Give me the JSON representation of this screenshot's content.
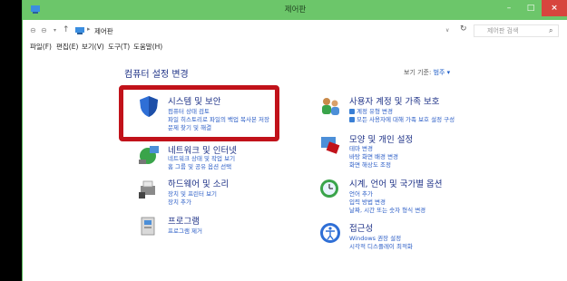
{
  "window": {
    "title": "제어판",
    "min_label": "–",
    "max_label": "□",
    "close_label": "×"
  },
  "address": {
    "back": "⊖",
    "forward": "⊖",
    "dropdown": "▾",
    "up": "↑",
    "separator": "▸",
    "path": "제어판",
    "path_dropdown": "∨",
    "refresh": "↻",
    "search_placeholder": "제어판 검색",
    "search_icon": "⌕"
  },
  "menu": [
    "파일(F)",
    "편집(E)",
    "보기(V)",
    "도구(T)",
    "도움말(H)"
  ],
  "content": {
    "title": "컴퓨터 설정 변경",
    "view_by_label": "보기 기준:",
    "view_by_value": "범주 ▾"
  },
  "categories": {
    "system": {
      "title": "시스템 및 보안",
      "links": [
        "컴퓨터 상태 검토",
        "파일 히스토리로 파일의 백업 복사본 저장",
        "문제 찾기 및 해결"
      ]
    },
    "network": {
      "title": "네트워크 및 인터넷",
      "links": [
        "네트워크 상태 및 작업 보기",
        "홈 그룹 및 공유 옵션 선택"
      ]
    },
    "hardware": {
      "title": "하드웨어 및 소리",
      "links": [
        "장치 및 프린터 보기",
        "장치 추가"
      ]
    },
    "programs": {
      "title": "프로그램",
      "links": [
        "프로그램 제거"
      ]
    },
    "accounts": {
      "title": "사용자 계정 및 가족 보호",
      "links": [
        "계정 유형 변경",
        "모든 사용자에 대해 가족 보호 설정 구성"
      ]
    },
    "appearance": {
      "title": "모양 및 개인 설정",
      "links": [
        "테마 변경",
        "바탕 화면 배경 변경",
        "화면 해상도 조정"
      ]
    },
    "clock": {
      "title": "시계, 언어 및 국가별 옵션",
      "links": [
        "언어 추가",
        "입력 방법 변경",
        "날짜, 시간 또는 숫자 형식 변경"
      ]
    },
    "ease": {
      "title": "접근성",
      "links": [
        "Windows 권장 설정",
        "시각적 디스플레이 최적화"
      ]
    }
  },
  "colors": {
    "titlebar": "#6cc66a",
    "close": "#d7453e",
    "link": "#2a5cc6",
    "heading": "#1e3287",
    "highlight": "#c1121a"
  }
}
